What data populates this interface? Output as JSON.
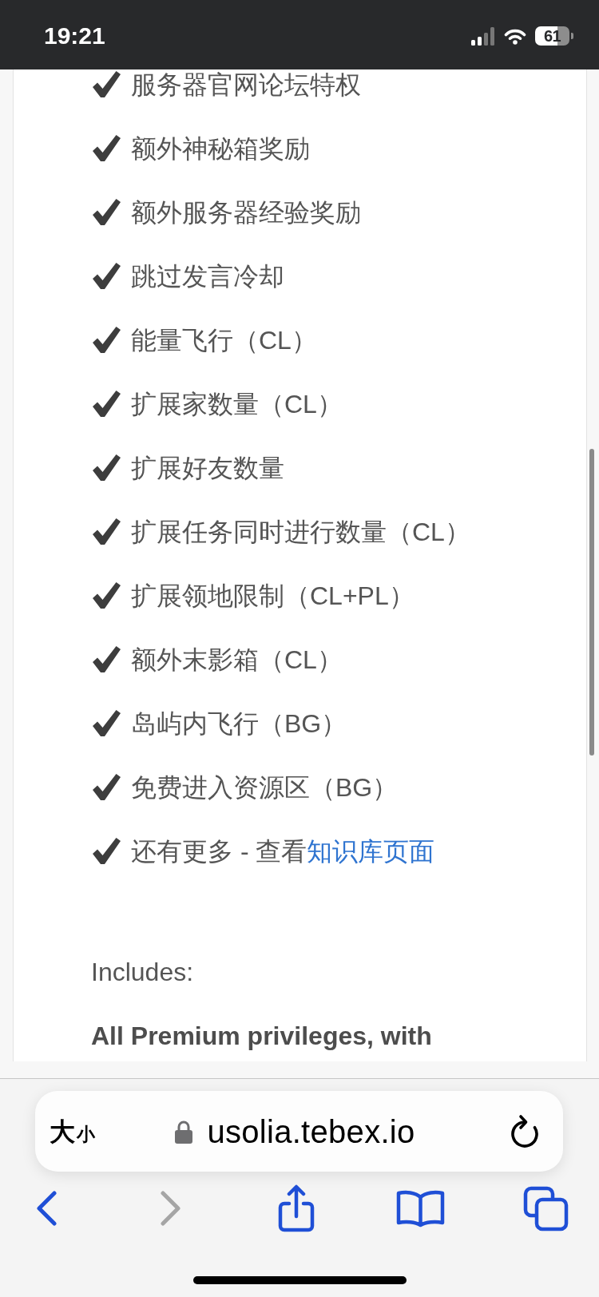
{
  "status_bar": {
    "time": "19:21",
    "battery": "61"
  },
  "features": [
    {
      "text": "服务器官网论坛特权"
    },
    {
      "text": "额外神秘箱奖励"
    },
    {
      "text": "额外服务器经验奖励"
    },
    {
      "text": "跳过发言冷却"
    },
    {
      "text": "能量飞行（CL）"
    },
    {
      "text": "扩展家数量（CL）"
    },
    {
      "text": "扩展好友数量"
    },
    {
      "text": "扩展任务同时进行数量（CL）"
    },
    {
      "text": "扩展领地限制（CL+PL）"
    },
    {
      "text": "额外末影箱（CL）"
    },
    {
      "text": "岛屿内飞行（BG）"
    },
    {
      "text": "免费进入资源区（BG）"
    },
    {
      "text": "还有更多 - 查看",
      "link": "知识库页面"
    }
  ],
  "includes": {
    "label": "Includes:",
    "summary": "All Premium privileges, with"
  },
  "browser": {
    "text_size": {
      "large": "大",
      "small": "小"
    },
    "url": "usolia.tebex.io",
    "toolbar": [
      {
        "kind": "back",
        "disabled": false
      },
      {
        "kind": "forward",
        "disabled": true
      },
      {
        "kind": "share",
        "disabled": false
      },
      {
        "kind": "bookmarks",
        "disabled": false
      },
      {
        "kind": "tabs",
        "disabled": false
      }
    ]
  }
}
